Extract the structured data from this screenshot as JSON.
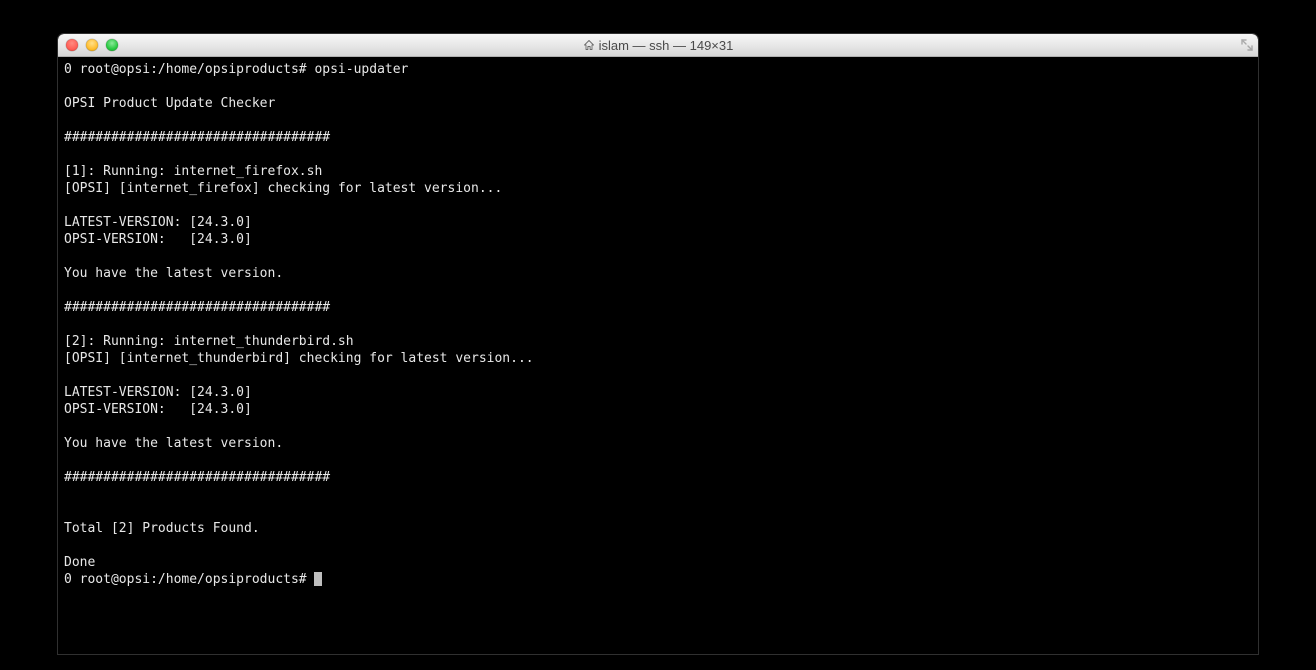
{
  "window": {
    "title": "islam — ssh — 149×31"
  },
  "terminal": {
    "line01": "0 root@opsi:/home/opsiproducts# opsi-updater",
    "line02": "",
    "line03": "OPSI Product Update Checker",
    "line04": "",
    "line05": "##################################",
    "line06": "",
    "line07": "[1]: Running: internet_firefox.sh",
    "line08": "[OPSI] [internet_firefox] checking for latest version...",
    "line09": "",
    "line10": "LATEST-VERSION: [24.3.0]",
    "line11": "OPSI-VERSION:   [24.3.0]",
    "line12": "",
    "line13": "You have the latest version.",
    "line14": "",
    "line15": "##################################",
    "line16": "",
    "line17": "[2]: Running: internet_thunderbird.sh",
    "line18": "[OPSI] [internet_thunderbird] checking for latest version...",
    "line19": "",
    "line20": "LATEST-VERSION: [24.3.0]",
    "line21": "OPSI-VERSION:   [24.3.0]",
    "line22": "",
    "line23": "You have the latest version.",
    "line24": "",
    "line25": "##################################",
    "line26": "",
    "line27": "",
    "line28": "Total [2] Products Found.",
    "line29": "",
    "line30": "Done",
    "line31": "0 root@opsi:/home/opsiproducts# "
  }
}
